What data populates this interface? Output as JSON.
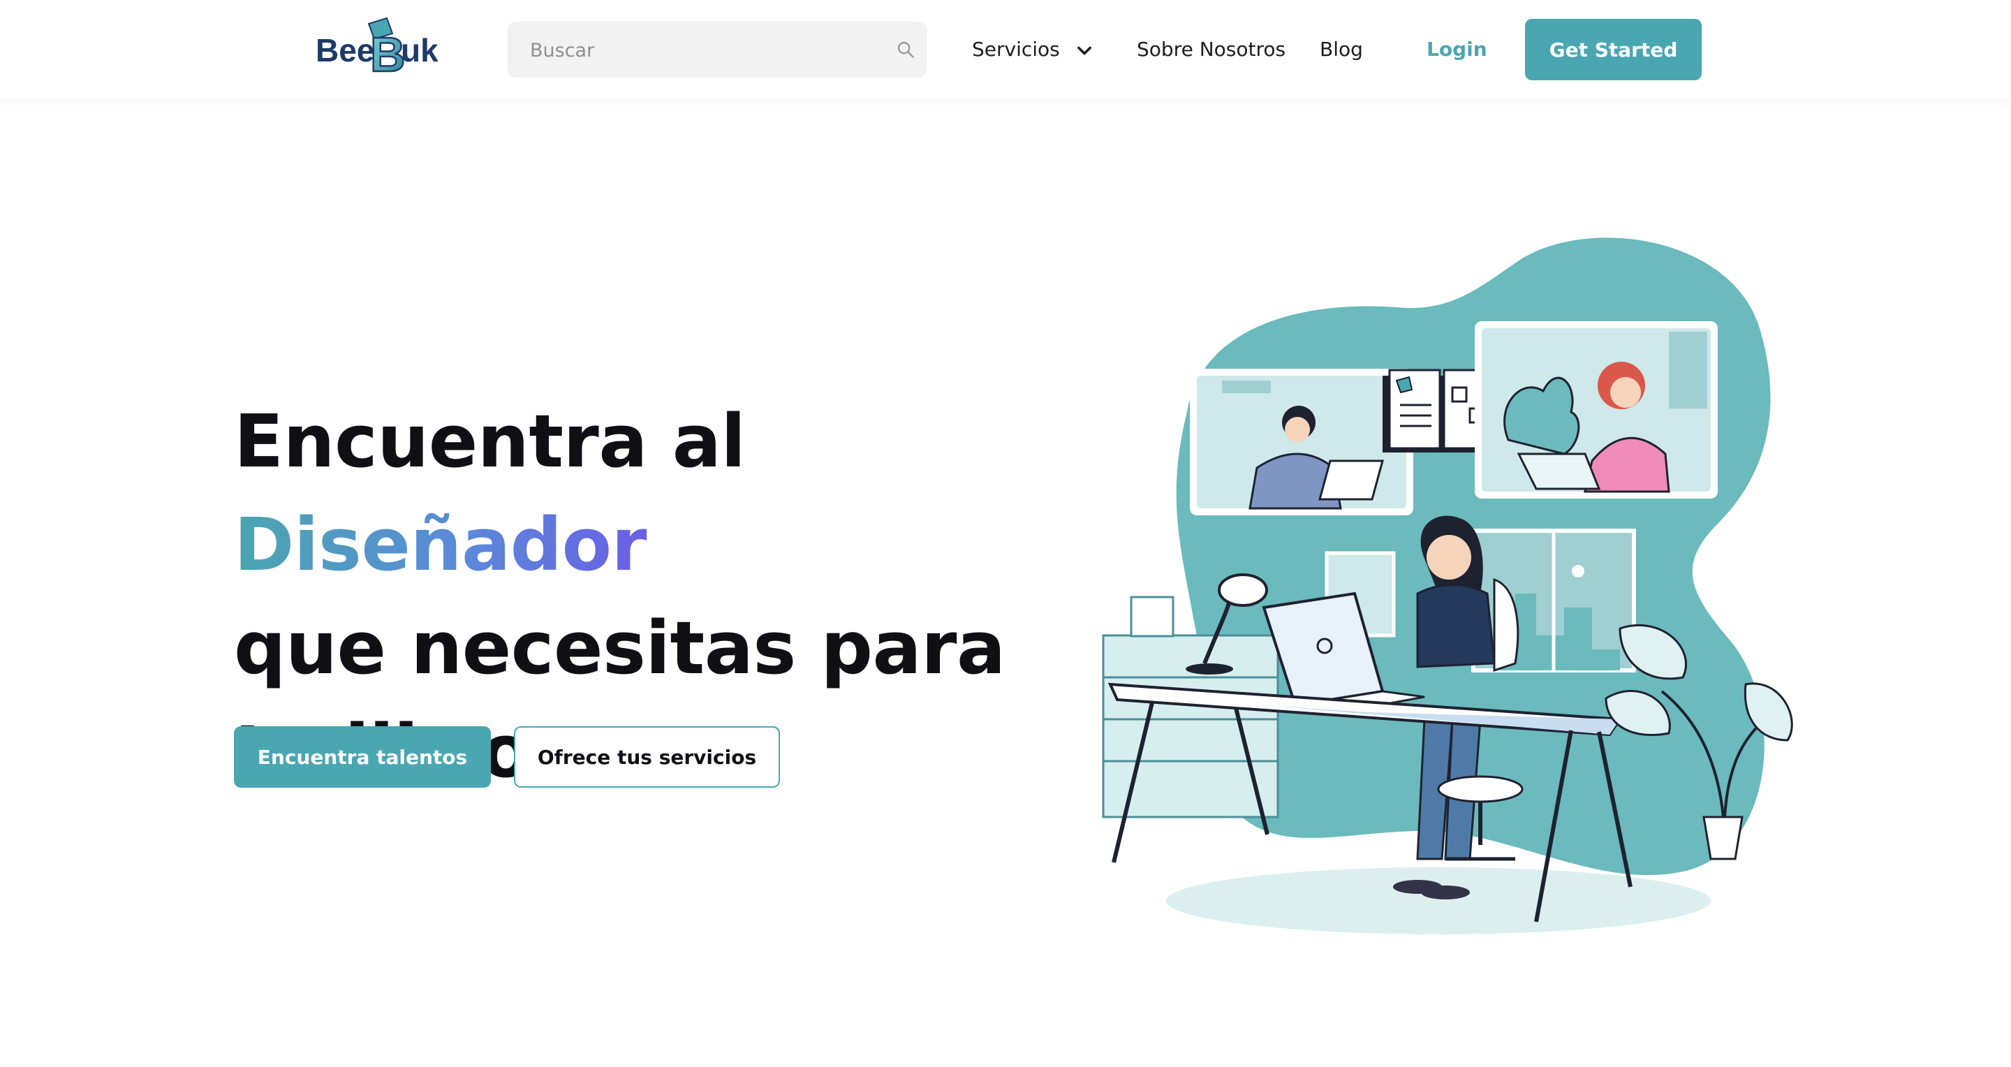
{
  "header": {
    "logo": {
      "text_left": "Bee",
      "text_letter": "B",
      "text_right": "uk"
    },
    "search": {
      "placeholder": "Buscar"
    },
    "nav": {
      "services": "Servicios",
      "about": "Sobre Nosotros",
      "blog": "Blog",
      "login": "Login"
    },
    "cta": "Get Started"
  },
  "hero": {
    "title_part1": "Encuentra al ",
    "title_highlight": "Diseñador",
    "title_line2": "que necesitas para",
    "title_line3": "tu libro",
    "primary_button": "Encuentra talentos",
    "secondary_button": "Ofrece tus servicios"
  },
  "icons": {
    "search": "search-icon",
    "dropdown": "chevron-down-icon"
  },
  "colors": {
    "brand": "#4aa6b1",
    "logo_navy": "#1f3a68",
    "title": "#0f0f14",
    "highlight_gradient": [
      "#4aa6b1",
      "#6a5fe6"
    ]
  }
}
